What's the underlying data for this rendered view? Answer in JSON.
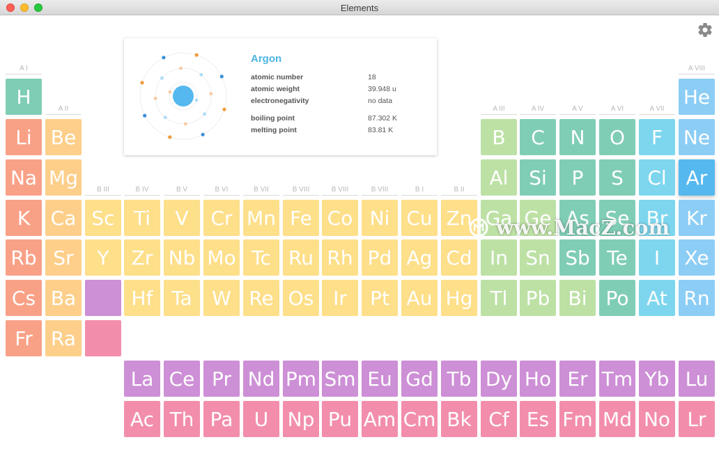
{
  "window": {
    "title": "Elements"
  },
  "colors": {
    "alkali": "#f9a187",
    "alkaline": "#fdcf8a",
    "transition": "#fedf8a",
    "metal": "#bde1a5",
    "metalloid": "#80cdb6",
    "nonmetal": "#7fd5d8",
    "halogen": "#7dd6ee",
    "noble": "#8ccdf5",
    "selected": "#55b8ef",
    "lanthanide": "#cd8fd6",
    "actinide": "#f28eac",
    "accent": "#4cb5e3"
  },
  "groups": [
    {
      "label": "A I",
      "col": 1,
      "row": 1
    },
    {
      "label": "A II",
      "col": 2,
      "row": 2
    },
    {
      "label": "B III",
      "col": 3,
      "row": 4
    },
    {
      "label": "B IV",
      "col": 4,
      "row": 4
    },
    {
      "label": "B V",
      "col": 5,
      "row": 4
    },
    {
      "label": "B VI",
      "col": 6,
      "row": 4
    },
    {
      "label": "B VII",
      "col": 7,
      "row": 4
    },
    {
      "label": "B VIII",
      "col": 8,
      "row": 4
    },
    {
      "label": "B VIII",
      "col": 9,
      "row": 4
    },
    {
      "label": "B VIII",
      "col": 10,
      "row": 4
    },
    {
      "label": "B I",
      "col": 11,
      "row": 4
    },
    {
      "label": "B II",
      "col": 12,
      "row": 4
    },
    {
      "label": "A III",
      "col": 13,
      "row": 2
    },
    {
      "label": "A IV",
      "col": 14,
      "row": 2
    },
    {
      "label": "A V",
      "col": 15,
      "row": 2
    },
    {
      "label": "A VI",
      "col": 16,
      "row": 2
    },
    {
      "label": "A VII",
      "col": 17,
      "row": 2
    },
    {
      "label": "A VIII",
      "col": 18,
      "row": 1
    }
  ],
  "elements": [
    {
      "symbol": "H",
      "col": 1,
      "row": 1,
      "cat": "metalloid"
    },
    {
      "symbol": "He",
      "col": 18,
      "row": 1,
      "cat": "noble"
    },
    {
      "symbol": "Li",
      "col": 1,
      "row": 2,
      "cat": "alkali"
    },
    {
      "symbol": "Be",
      "col": 2,
      "row": 2,
      "cat": "alkaline"
    },
    {
      "symbol": "B",
      "col": 13,
      "row": 2,
      "cat": "metal"
    },
    {
      "symbol": "C",
      "col": 14,
      "row": 2,
      "cat": "metalloid"
    },
    {
      "symbol": "N",
      "col": 15,
      "row": 2,
      "cat": "metalloid"
    },
    {
      "symbol": "O",
      "col": 16,
      "row": 2,
      "cat": "metalloid"
    },
    {
      "symbol": "F",
      "col": 17,
      "row": 2,
      "cat": "halogen"
    },
    {
      "symbol": "Ne",
      "col": 18,
      "row": 2,
      "cat": "noble"
    },
    {
      "symbol": "Na",
      "col": 1,
      "row": 3,
      "cat": "alkali"
    },
    {
      "symbol": "Mg",
      "col": 2,
      "row": 3,
      "cat": "alkaline"
    },
    {
      "symbol": "Al",
      "col": 13,
      "row": 3,
      "cat": "metal"
    },
    {
      "symbol": "Si",
      "col": 14,
      "row": 3,
      "cat": "metalloid"
    },
    {
      "symbol": "P",
      "col": 15,
      "row": 3,
      "cat": "metalloid"
    },
    {
      "symbol": "S",
      "col": 16,
      "row": 3,
      "cat": "metalloid"
    },
    {
      "symbol": "Cl",
      "col": 17,
      "row": 3,
      "cat": "halogen"
    },
    {
      "symbol": "Ar",
      "col": 18,
      "row": 3,
      "cat": "selected"
    },
    {
      "symbol": "K",
      "col": 1,
      "row": 4,
      "cat": "alkali"
    },
    {
      "symbol": "Ca",
      "col": 2,
      "row": 4,
      "cat": "alkaline"
    },
    {
      "symbol": "Sc",
      "col": 3,
      "row": 4,
      "cat": "transition"
    },
    {
      "symbol": "Ti",
      "col": 4,
      "row": 4,
      "cat": "transition"
    },
    {
      "symbol": "V",
      "col": 5,
      "row": 4,
      "cat": "transition"
    },
    {
      "symbol": "Cr",
      "col": 6,
      "row": 4,
      "cat": "transition"
    },
    {
      "symbol": "Mn",
      "col": 7,
      "row": 4,
      "cat": "transition"
    },
    {
      "symbol": "Fe",
      "col": 8,
      "row": 4,
      "cat": "transition"
    },
    {
      "symbol": "Co",
      "col": 9,
      "row": 4,
      "cat": "transition"
    },
    {
      "symbol": "Ni",
      "col": 10,
      "row": 4,
      "cat": "transition"
    },
    {
      "symbol": "Cu",
      "col": 11,
      "row": 4,
      "cat": "transition"
    },
    {
      "symbol": "Zn",
      "col": 12,
      "row": 4,
      "cat": "transition"
    },
    {
      "symbol": "Ga",
      "col": 13,
      "row": 4,
      "cat": "metal"
    },
    {
      "symbol": "Ge",
      "col": 14,
      "row": 4,
      "cat": "metal"
    },
    {
      "symbol": "As",
      "col": 15,
      "row": 4,
      "cat": "metalloid"
    },
    {
      "symbol": "Se",
      "col": 16,
      "row": 4,
      "cat": "metalloid"
    },
    {
      "symbol": "Br",
      "col": 17,
      "row": 4,
      "cat": "halogen"
    },
    {
      "symbol": "Kr",
      "col": 18,
      "row": 4,
      "cat": "noble"
    },
    {
      "symbol": "Rb",
      "col": 1,
      "row": 5,
      "cat": "alkali"
    },
    {
      "symbol": "Sr",
      "col": 2,
      "row": 5,
      "cat": "alkaline"
    },
    {
      "symbol": "Y",
      "col": 3,
      "row": 5,
      "cat": "transition"
    },
    {
      "symbol": "Zr",
      "col": 4,
      "row": 5,
      "cat": "transition"
    },
    {
      "symbol": "Nb",
      "col": 5,
      "row": 5,
      "cat": "transition"
    },
    {
      "symbol": "Mo",
      "col": 6,
      "row": 5,
      "cat": "transition"
    },
    {
      "symbol": "Tc",
      "col": 7,
      "row": 5,
      "cat": "transition"
    },
    {
      "symbol": "Ru",
      "col": 8,
      "row": 5,
      "cat": "transition"
    },
    {
      "symbol": "Rh",
      "col": 9,
      "row": 5,
      "cat": "transition"
    },
    {
      "symbol": "Pd",
      "col": 10,
      "row": 5,
      "cat": "transition"
    },
    {
      "symbol": "Ag",
      "col": 11,
      "row": 5,
      "cat": "transition"
    },
    {
      "symbol": "Cd",
      "col": 12,
      "row": 5,
      "cat": "transition"
    },
    {
      "symbol": "In",
      "col": 13,
      "row": 5,
      "cat": "metal"
    },
    {
      "symbol": "Sn",
      "col": 14,
      "row": 5,
      "cat": "metal"
    },
    {
      "symbol": "Sb",
      "col": 15,
      "row": 5,
      "cat": "metalloid"
    },
    {
      "symbol": "Te",
      "col": 16,
      "row": 5,
      "cat": "metalloid"
    },
    {
      "symbol": "I",
      "col": 17,
      "row": 5,
      "cat": "halogen"
    },
    {
      "symbol": "Xe",
      "col": 18,
      "row": 5,
      "cat": "noble"
    },
    {
      "symbol": "Cs",
      "col": 1,
      "row": 6,
      "cat": "alkali"
    },
    {
      "symbol": "Ba",
      "col": 2,
      "row": 6,
      "cat": "alkaline"
    },
    {
      "symbol": "",
      "col": 3,
      "row": 6,
      "cat": "lanthanide"
    },
    {
      "symbol": "Hf",
      "col": 4,
      "row": 6,
      "cat": "transition"
    },
    {
      "symbol": "Ta",
      "col": 5,
      "row": 6,
      "cat": "transition"
    },
    {
      "symbol": "W",
      "col": 6,
      "row": 6,
      "cat": "transition"
    },
    {
      "symbol": "Re",
      "col": 7,
      "row": 6,
      "cat": "transition"
    },
    {
      "symbol": "Os",
      "col": 8,
      "row": 6,
      "cat": "transition"
    },
    {
      "symbol": "Ir",
      "col": 9,
      "row": 6,
      "cat": "transition"
    },
    {
      "symbol": "Pt",
      "col": 10,
      "row": 6,
      "cat": "transition"
    },
    {
      "symbol": "Au",
      "col": 11,
      "row": 6,
      "cat": "transition"
    },
    {
      "symbol": "Hg",
      "col": 12,
      "row": 6,
      "cat": "transition"
    },
    {
      "symbol": "Tl",
      "col": 13,
      "row": 6,
      "cat": "metal"
    },
    {
      "symbol": "Pb",
      "col": 14,
      "row": 6,
      "cat": "metal"
    },
    {
      "symbol": "Bi",
      "col": 15,
      "row": 6,
      "cat": "metal"
    },
    {
      "symbol": "Po",
      "col": 16,
      "row": 6,
      "cat": "metalloid"
    },
    {
      "symbol": "At",
      "col": 17,
      "row": 6,
      "cat": "halogen"
    },
    {
      "symbol": "Rn",
      "col": 18,
      "row": 6,
      "cat": "noble"
    },
    {
      "symbol": "Fr",
      "col": 1,
      "row": 7,
      "cat": "alkali"
    },
    {
      "symbol": "Ra",
      "col": 2,
      "row": 7,
      "cat": "alkaline"
    },
    {
      "symbol": "",
      "col": 3,
      "row": 7,
      "cat": "actinide"
    },
    {
      "symbol": "La",
      "col": 4,
      "row": 8,
      "cat": "lanthanide"
    },
    {
      "symbol": "Ce",
      "col": 5,
      "row": 8,
      "cat": "lanthanide"
    },
    {
      "symbol": "Pr",
      "col": 6,
      "row": 8,
      "cat": "lanthanide"
    },
    {
      "symbol": "Nd",
      "col": 7,
      "row": 8,
      "cat": "lanthanide"
    },
    {
      "symbol": "Pm",
      "col": 8,
      "row": 8,
      "cat": "lanthanide"
    },
    {
      "symbol": "Sm",
      "col": 9,
      "row": 8,
      "cat": "lanthanide"
    },
    {
      "symbol": "Eu",
      "col": 10,
      "row": 8,
      "cat": "lanthanide"
    },
    {
      "symbol": "Gd",
      "col": 11,
      "row": 8,
      "cat": "lanthanide"
    },
    {
      "symbol": "Tb",
      "col": 12,
      "row": 8,
      "cat": "lanthanide"
    },
    {
      "symbol": "Dy",
      "col": 13,
      "row": 8,
      "cat": "lanthanide"
    },
    {
      "symbol": "Ho",
      "col": 14,
      "row": 8,
      "cat": "lanthanide"
    },
    {
      "symbol": "Er",
      "col": 15,
      "row": 8,
      "cat": "lanthanide"
    },
    {
      "symbol": "Tm",
      "col": 16,
      "row": 8,
      "cat": "lanthanide"
    },
    {
      "symbol": "Yb",
      "col": 17,
      "row": 8,
      "cat": "lanthanide"
    },
    {
      "symbol": "Lu",
      "col": 18,
      "row": 8,
      "cat": "lanthanide"
    },
    {
      "symbol": "Ac",
      "col": 4,
      "row": 9,
      "cat": "actinide"
    },
    {
      "symbol": "Th",
      "col": 5,
      "row": 9,
      "cat": "actinide"
    },
    {
      "symbol": "Pa",
      "col": 6,
      "row": 9,
      "cat": "actinide"
    },
    {
      "symbol": "U",
      "col": 7,
      "row": 9,
      "cat": "actinide"
    },
    {
      "symbol": "Np",
      "col": 8,
      "row": 9,
      "cat": "actinide"
    },
    {
      "symbol": "Pu",
      "col": 9,
      "row": 9,
      "cat": "actinide"
    },
    {
      "symbol": "Am",
      "col": 10,
      "row": 9,
      "cat": "actinide"
    },
    {
      "symbol": "Cm",
      "col": 11,
      "row": 9,
      "cat": "actinide"
    },
    {
      "symbol": "Bk",
      "col": 12,
      "row": 9,
      "cat": "actinide"
    },
    {
      "symbol": "Cf",
      "col": 13,
      "row": 9,
      "cat": "actinide"
    },
    {
      "symbol": "Es",
      "col": 14,
      "row": 9,
      "cat": "actinide"
    },
    {
      "symbol": "Fm",
      "col": 15,
      "row": 9,
      "cat": "actinide"
    },
    {
      "symbol": "Md",
      "col": 16,
      "row": 9,
      "cat": "actinide"
    },
    {
      "symbol": "No",
      "col": 17,
      "row": 9,
      "cat": "actinide"
    },
    {
      "symbol": "Lr",
      "col": 18,
      "row": 9,
      "cat": "actinide"
    }
  ],
  "selected": {
    "name": "Argon",
    "atomic_number_label": "atomic number",
    "atomic_number": "18",
    "atomic_weight_label": "atomic weight",
    "atomic_weight": "39.948 u",
    "electronegativity_label": "electronegativity",
    "electronegativity": "no data",
    "boiling_point_label": "boiling point",
    "boiling_point": "87.302 K",
    "melting_point_label": "melting point",
    "melting_point": "83.81 K",
    "shells": [
      2,
      8,
      8
    ]
  },
  "watermark": "www.MacZ.com",
  "icons": {
    "settings": "gear-icon",
    "watermark": "macz-logo-icon"
  }
}
